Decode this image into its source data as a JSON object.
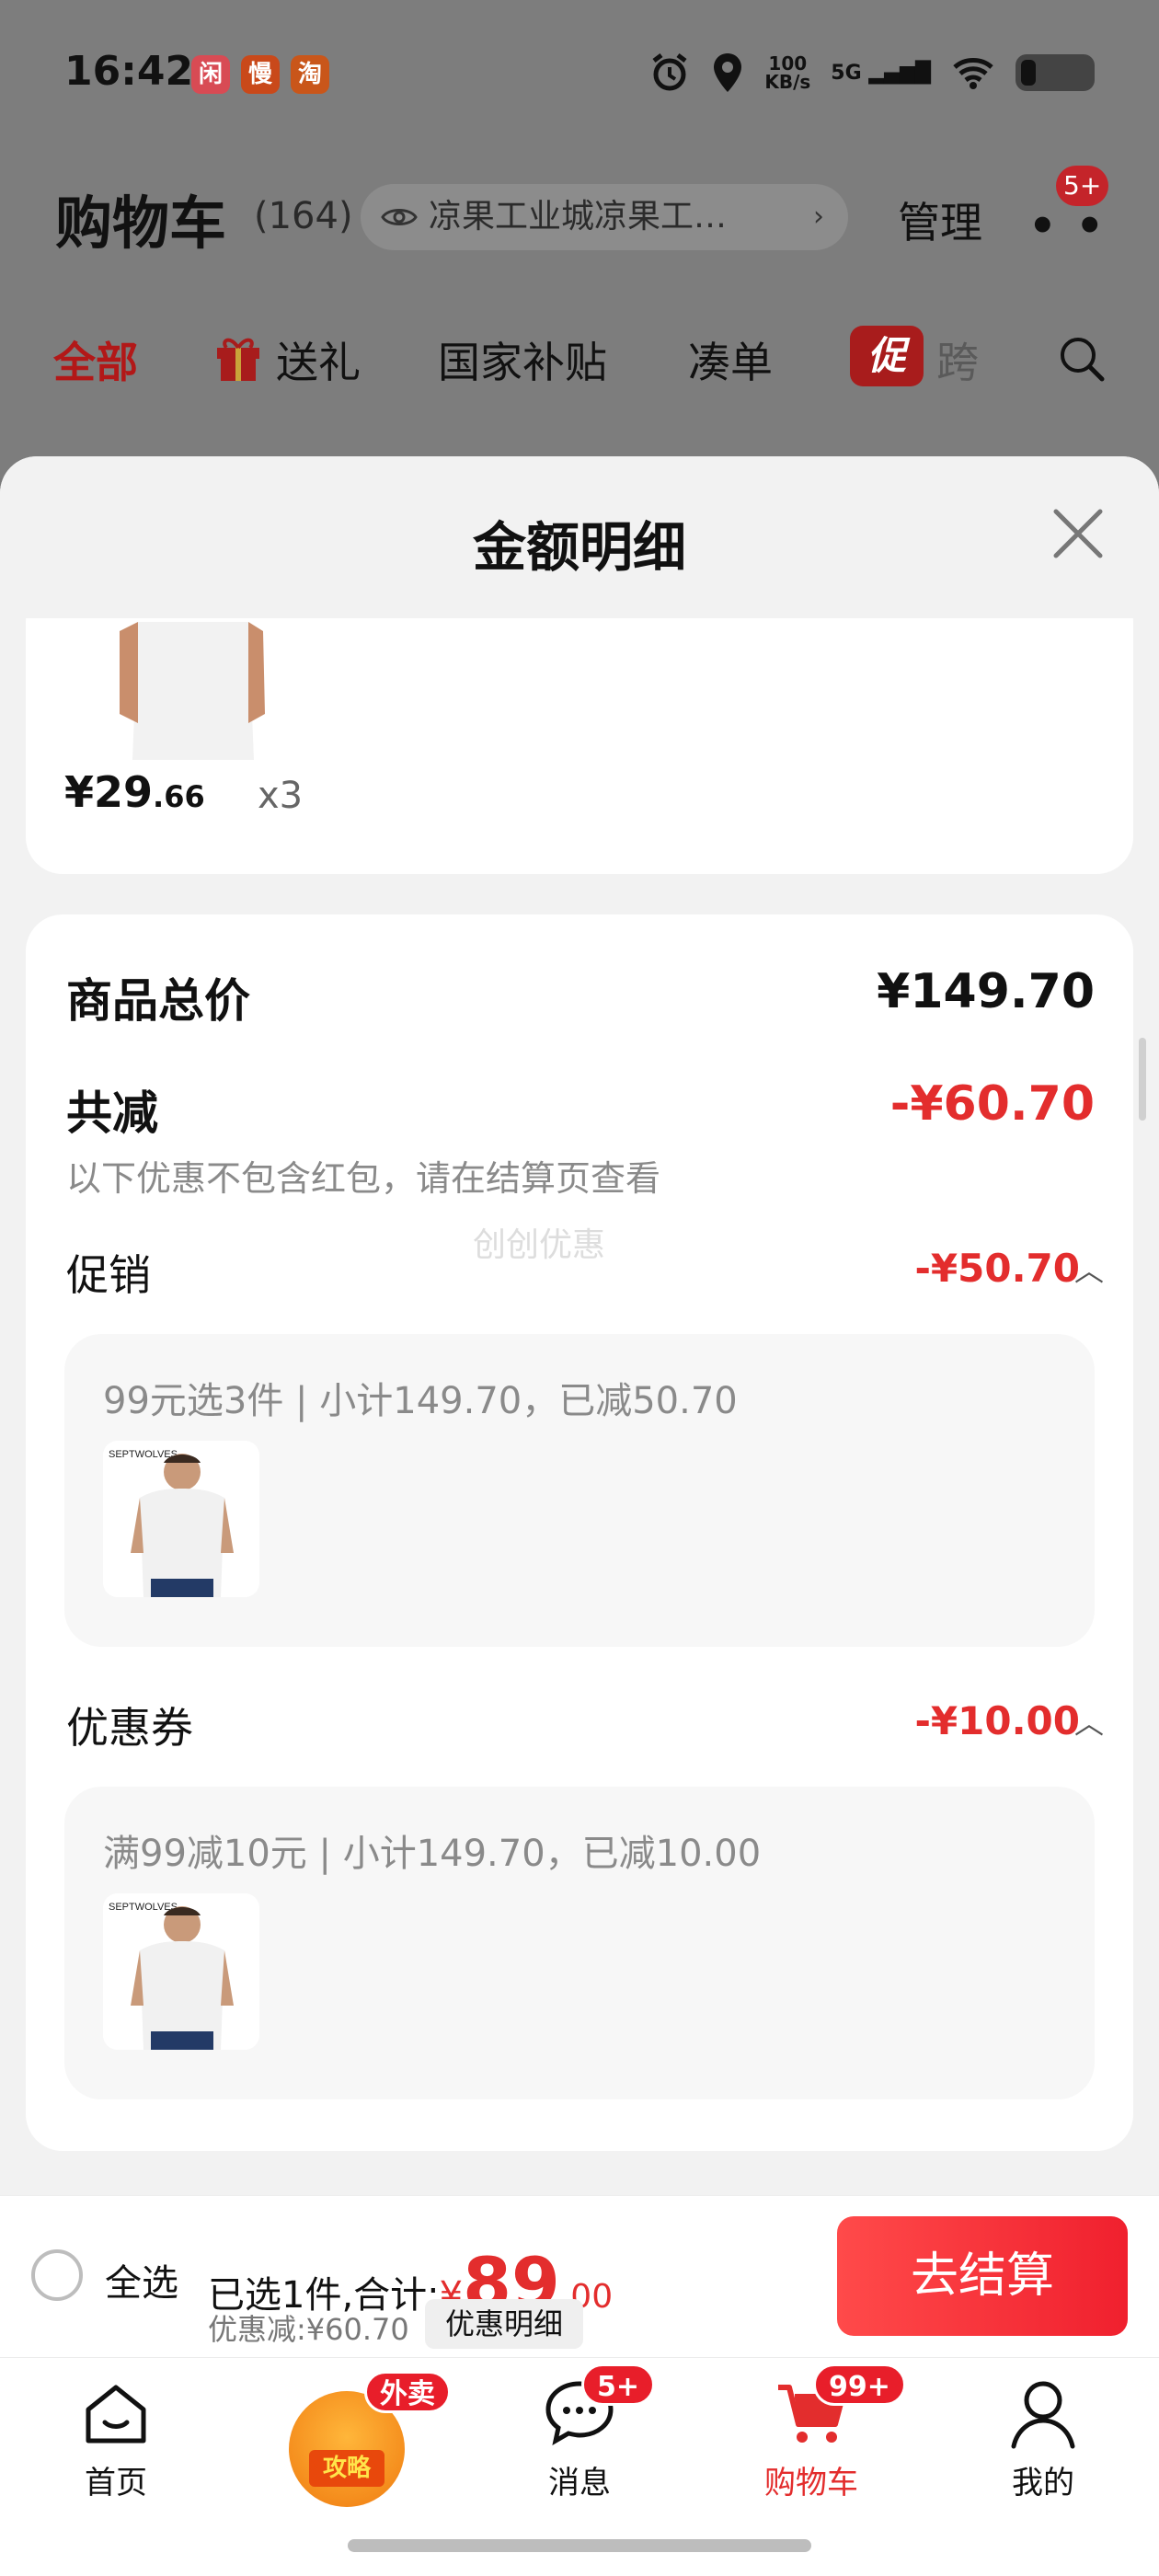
{
  "status_bar": {
    "time": "16:42",
    "app_badges": [
      {
        "label": "闲",
        "color": "#d84b54"
      },
      {
        "label": "慢",
        "color": "#c9491a"
      },
      {
        "label": "淘",
        "color": "#c9561a"
      }
    ],
    "net_speed_value": "100",
    "net_speed_unit": "KB/s",
    "network": "5G"
  },
  "cart_header": {
    "title": "购物车",
    "count": "(164)",
    "address": "凉果工业城凉果工…",
    "manage": "管理",
    "more_badge": "5+"
  },
  "tabs": [
    {
      "label": "全部",
      "active": true
    },
    {
      "label": "送礼",
      "active": false
    },
    {
      "label": "国家补贴",
      "active": false
    },
    {
      "label": "凑单",
      "active": false
    },
    {
      "label": "跨",
      "active": false
    }
  ],
  "promo_chip": "促",
  "sheet": {
    "title": "金额明细",
    "item_price_int": "¥29",
    "item_price_dec": ".66",
    "item_qty": "x3",
    "goods_total_label": "商品总价",
    "goods_total": "¥149.70",
    "reduce_label": "共减",
    "reduce_total": "-¥60.70",
    "reduce_note": "以下优惠不包含红包，请在结算页查看",
    "watermark": "创创优惠",
    "promo_label": "促销",
    "promo_amount": "-¥50.70",
    "promo_desc": "99元选3件 | 小计149.70，已减50.70",
    "coupon_label": "优惠券",
    "coupon_amount": "-¥10.00",
    "coupon_desc": "满99减10元 | 小计149.70，已减10.00"
  },
  "checkout": {
    "select_all": "全选",
    "selected_prefix": "已选1件,合计:",
    "total_symbol": "¥",
    "total_int": "89",
    "total_dec": ".00",
    "discount": "优惠减:¥60.70",
    "detail_button": "优惠明细",
    "pay_button": "去结算"
  },
  "bottom_nav": [
    {
      "label": "首页",
      "icon": "home-icon"
    },
    {
      "label": "",
      "icon": "gonglue-icon",
      "badge": "外卖",
      "inner": "攻略"
    },
    {
      "label": "消息",
      "icon": "message-icon",
      "badge": "5+"
    },
    {
      "label": "购物车",
      "icon": "cart-icon",
      "badge": "99+",
      "active": true
    },
    {
      "label": "我的",
      "icon": "profile-icon"
    }
  ],
  "colors": {
    "accent": "#e32d2d",
    "text": "#111111",
    "muted": "#8a8a8a"
  }
}
